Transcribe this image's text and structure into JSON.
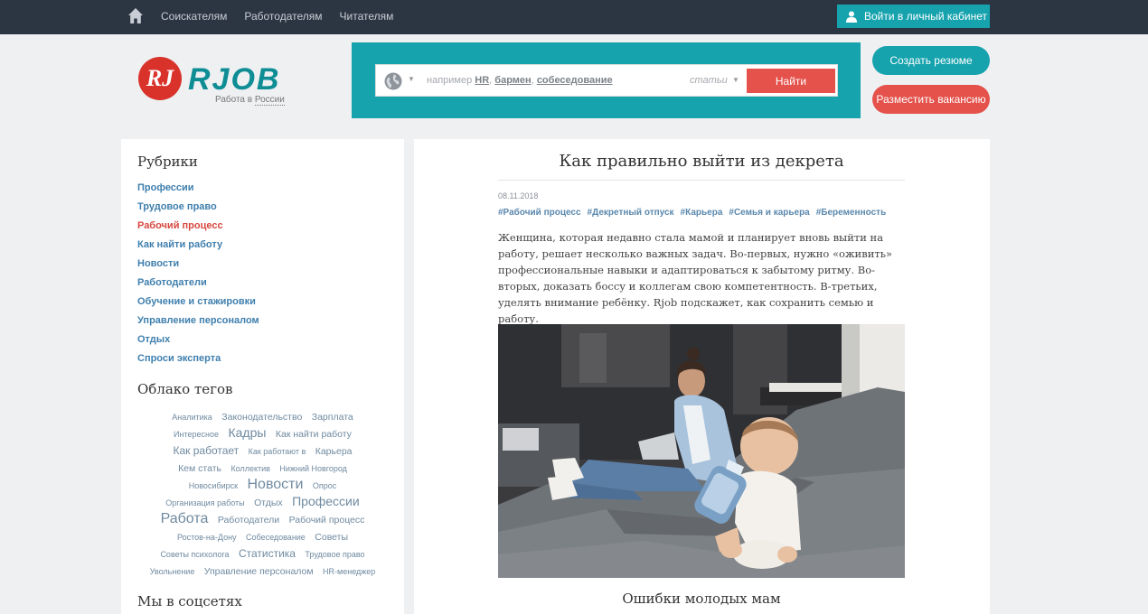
{
  "topbar": {
    "nav": [
      "Соискателям",
      "Работодателям",
      "Читателям"
    ],
    "login": "Войти в личный кабинет"
  },
  "logo": {
    "text": "RJOB",
    "sub_prefix": "Работа в",
    "sub_link": "России"
  },
  "search": {
    "hint_prefix": "например",
    "hint_links": [
      "HR",
      "бармен",
      "собеседование"
    ],
    "scope": "статьи",
    "button": "Найти"
  },
  "cta": {
    "resume": "Создать резюме",
    "vacancy": "Разместить вакансию"
  },
  "sidebar": {
    "rubrics_title": "Рубрики",
    "rubrics": [
      {
        "label": "Профессии",
        "active": false
      },
      {
        "label": "Трудовое право",
        "active": false
      },
      {
        "label": "Рабочий процесс",
        "active": true
      },
      {
        "label": "Как найти работу",
        "active": false
      },
      {
        "label": "Новости",
        "active": false
      },
      {
        "label": "Работодатели",
        "active": false
      },
      {
        "label": "Обучение и стажировки",
        "active": false
      },
      {
        "label": "Управление персоналом",
        "active": false
      },
      {
        "label": "Отдых",
        "active": false
      },
      {
        "label": "Спроси эксперта",
        "active": false
      }
    ],
    "cloud_title": "Облако тегов",
    "cloud": [
      {
        "t": "Аналитика",
        "s": 1
      },
      {
        "t": "Законодательство",
        "s": 2
      },
      {
        "t": "Зарплата",
        "s": 2
      },
      {
        "t": "Интересное",
        "s": 1
      },
      {
        "t": "Кадры",
        "s": 4
      },
      {
        "t": "Как найти работу",
        "s": 2
      },
      {
        "t": "Как работает",
        "s": 3
      },
      {
        "t": "Как работают в",
        "s": 1
      },
      {
        "t": "Карьера",
        "s": 2
      },
      {
        "t": "Кем стать",
        "s": 2
      },
      {
        "t": "Коллектив",
        "s": 1
      },
      {
        "t": "Нижний Новгород",
        "s": 1
      },
      {
        "t": "Новосибирск",
        "s": 1
      },
      {
        "t": "Новости",
        "s": 5
      },
      {
        "t": "Опрос",
        "s": 1
      },
      {
        "t": "Организация работы",
        "s": 1
      },
      {
        "t": "Отдых",
        "s": 2
      },
      {
        "t": "Профессии",
        "s": 4
      },
      {
        "t": "Работа",
        "s": 5
      },
      {
        "t": "Работодатели",
        "s": 2
      },
      {
        "t": "Рабочий процесс",
        "s": 2
      },
      {
        "t": "Ростов-на-Дону",
        "s": 1
      },
      {
        "t": "Собеседование",
        "s": 1
      },
      {
        "t": "Советы",
        "s": 2
      },
      {
        "t": "Советы психолога",
        "s": 1
      },
      {
        "t": "Статистика",
        "s": 3
      },
      {
        "t": "Трудовое право",
        "s": 1
      },
      {
        "t": "Увольнение",
        "s": 1
      },
      {
        "t": "Управление персоналом",
        "s": 2
      },
      {
        "t": "HR-менеджер",
        "s": 1
      }
    ],
    "social_title": "Мы в соцсетях",
    "social": [
      "vk",
      "f",
      "ok"
    ]
  },
  "article": {
    "title": "Как правильно выйти из декрета",
    "date": "08.11.2018",
    "tags": [
      "#Рабочий процесс",
      "#Декретный отпуск",
      "#Карьера",
      "#Семья и карьера",
      "#Беременность"
    ],
    "lead": "Женщина, которая недавно стала мамой и планирует вновь выйти на работу, решает несколько важных задач. Во-первых, нужно «оживить» профессиональные навыки и адаптироваться к забытому ритму. Во-вторых, доказать боссу и коллегам свою компетентность. В-третьих, уделять внимание ребёнку. Rjob подскажет, как сохранить семью и работу.",
    "subheading": "Ошибки молодых мам"
  },
  "colors": {
    "topbar": "#2c3542",
    "teal": "#16a3ae",
    "red": "#e4524b",
    "link": "#3f7fae",
    "active": "#d6473f"
  },
  "icons": {
    "home": "home-icon",
    "user": "user-icon",
    "globe": "globe-icon",
    "caret": "caret-down-icon"
  }
}
